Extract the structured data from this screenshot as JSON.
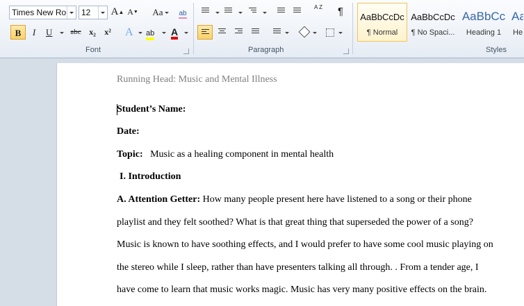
{
  "font_group": {
    "font_name": "Times New Rom",
    "font_size": "12",
    "grow_label": "A",
    "shrink_label": "A",
    "case_label": "Aa",
    "bold": "B",
    "italic": "I",
    "underline": "U",
    "strike": "abc",
    "subscript": "x₂",
    "superscript": "x²",
    "text_effects": "A",
    "highlight": "ab",
    "font_color": "A",
    "label": "Font",
    "highlight_color": "#ffff00",
    "font_color_value": "#e00000"
  },
  "paragraph_group": {
    "label": "Paragraph",
    "sort_label": "A Z",
    "pilcrow": "¶"
  },
  "styles_group": {
    "label": "Styles",
    "items": [
      {
        "preview": "AaBbCcDc",
        "name": "¶ Normal"
      },
      {
        "preview": "AaBbCcDc",
        "name": "¶ No Spaci..."
      },
      {
        "preview": "AaBbCc",
        "name": "Heading 1"
      },
      {
        "preview": "AaBbC",
        "name": "He"
      }
    ]
  },
  "document": {
    "running_head": "Running Head: Music and Mental Illness",
    "student_name_label": "Student’s Name:",
    "date_label": "Date:",
    "topic_label": "Topic:",
    "topic_text": "Music as a healing component in mental health",
    "section_heading": "I. Introduction",
    "attention_label": "A. Attention Getter:",
    "paragraph_lines": [
      " How many people present here have listened to a song or their phone",
      "playlist and they felt soothed? What is that great thing that superseded the power of a song?",
      "Music is known to have soothing effects, and I would prefer to have some cool music playing on",
      "the stereo while I sleep, rather than have presenters talking all through. . From a tender age, I",
      "have come to learn that music works magic. Music has very many positive effects on the brain."
    ]
  }
}
